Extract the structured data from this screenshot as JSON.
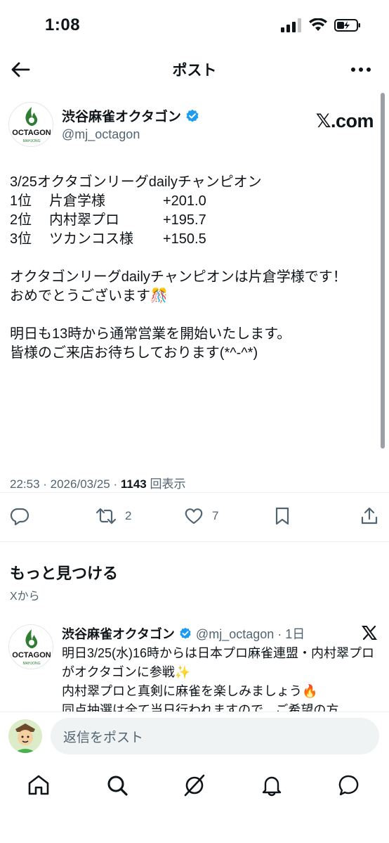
{
  "status": {
    "time": "1:08"
  },
  "nav": {
    "title": "ポスト",
    "back_icon": "arrow-left-icon",
    "more_icon": "more-icon"
  },
  "tweet": {
    "author_name": "渋谷麻雀オクタゴン",
    "author_handle": "@mj_octagon",
    "source_label": "𝕏.com",
    "avatar_text": "OCTAGON",
    "avatar_sub": "MAHJONG",
    "intro": "3/25オクタゴンリーグdailyチャンピオン",
    "ranks": [
      {
        "rank": "1位",
        "name": "片倉学様",
        "score": "+201.0"
      },
      {
        "rank": "2位",
        "name": "内村翠プロ",
        "score": "+195.7"
      },
      {
        "rank": "3位",
        "name": "ツカンコス様",
        "score": "+150.5"
      }
    ],
    "para1": "オクタゴンリーグdailyチャンピオンは片倉学様です！",
    "para2": "おめでとうございます🎊",
    "para3": "明日も13時から通常営業を開始いたします。",
    "para4": "皆様のご来店お待ちしております(*^-^*)",
    "time": "22:53 · 2026/03/25 · ",
    "views": "1143",
    "views_label": " 回表示",
    "retweets": "2",
    "likes": "7"
  },
  "discover": {
    "title": "もっと見つける",
    "sub": "Xから"
  },
  "related": {
    "name": "渋谷麻雀オクタゴン",
    "handle": "@mj_octagon · 1日",
    "text1": "明日3/25(水)16時からは日本プロ麻雀連盟・内村翠プロがオクタゴンに参戦✨",
    "text2": "内村翠プロと真剣に麻雀を楽しみましょう🔥",
    "text3": "同点抽選は全て当日行われますので、ご希望の方"
  },
  "reply": {
    "placeholder": "返信をポスト"
  },
  "bottom_nav": [
    "home-icon",
    "search-icon",
    "grok-icon",
    "notifications-icon",
    "messages-icon"
  ],
  "colors": {
    "verified": "#1d9bf0",
    "secondary_text": "#536471",
    "logo_green": "#2e7d32"
  }
}
